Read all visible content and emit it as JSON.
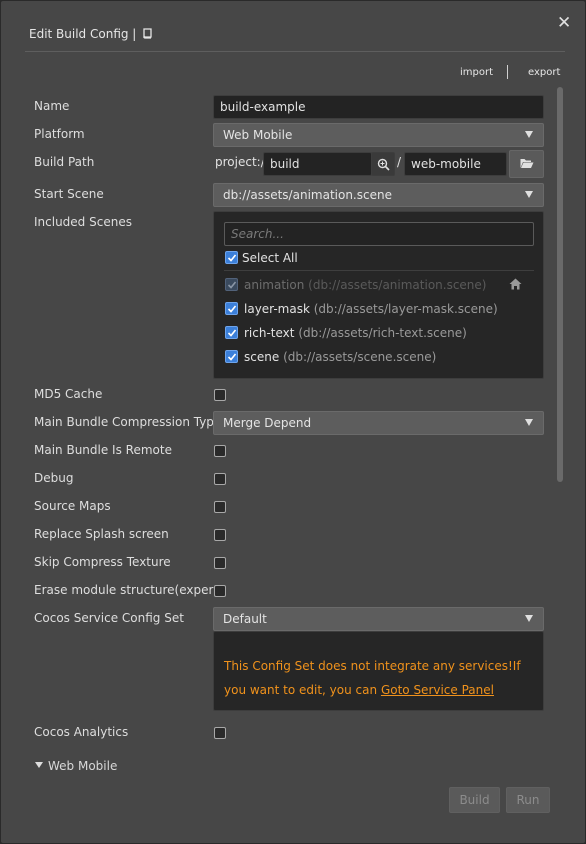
{
  "window": {
    "title": "Edit Build Config |",
    "close_label": "✕",
    "import_label": "import",
    "export_label": "export"
  },
  "form": {
    "name": {
      "label": "Name",
      "value": "build-example"
    },
    "platform": {
      "label": "Platform",
      "value": "Web Mobile"
    },
    "build_path": {
      "label": "Build Path",
      "prefix": "project://",
      "value": "build",
      "separator": "/",
      "suffix": "web-mobile"
    },
    "start_scene": {
      "label": "Start Scene",
      "value": "db://assets/animation.scene"
    },
    "included_scenes": {
      "label": "Included Scenes",
      "search_placeholder": "Search...",
      "select_all": "Select All",
      "scenes": [
        {
          "name": "animation",
          "path": "(db://assets/animation.scene)",
          "checked": true,
          "disabled": true
        },
        {
          "name": "layer-mask",
          "path": "(db://assets/layer-mask.scene)",
          "checked": true,
          "disabled": false
        },
        {
          "name": "rich-text",
          "path": "(db://assets/rich-text.scene)",
          "checked": true,
          "disabled": false
        },
        {
          "name": "scene",
          "path": "(db://assets/scene.scene)",
          "checked": true,
          "disabled": false
        }
      ]
    },
    "md5_cache": {
      "label": "MD5 Cache",
      "checked": false
    },
    "main_bundle_compression": {
      "label": "Main Bundle Compression Type",
      "value": "Merge Depend"
    },
    "main_bundle_remote": {
      "label": "Main Bundle Is Remote",
      "checked": false
    },
    "debug": {
      "label": "Debug",
      "checked": false
    },
    "source_maps": {
      "label": "Source Maps",
      "checked": false
    },
    "replace_splash": {
      "label": "Replace Splash screen",
      "checked": false
    },
    "skip_compress_texture": {
      "label": "Skip Compress Texture",
      "checked": false
    },
    "erase_module_structure": {
      "label": "Erase module structure(exper…",
      "checked": false
    },
    "service_config_set": {
      "label": "Cocos Service Config Set",
      "value": "Default",
      "notice_text": "This Config Set does not integrate any services!If you want to edit, you can",
      "notice_link": "Goto Service Panel"
    },
    "cocos_analytics": {
      "label": "Cocos Analytics",
      "checked": false
    },
    "platform_section": "Web Mobile"
  },
  "footer": {
    "build_label": "Build",
    "run_label": "Run"
  },
  "colors": {
    "accent": "#3b7fd9",
    "warning": "#f0921c",
    "panel": "#474747"
  }
}
